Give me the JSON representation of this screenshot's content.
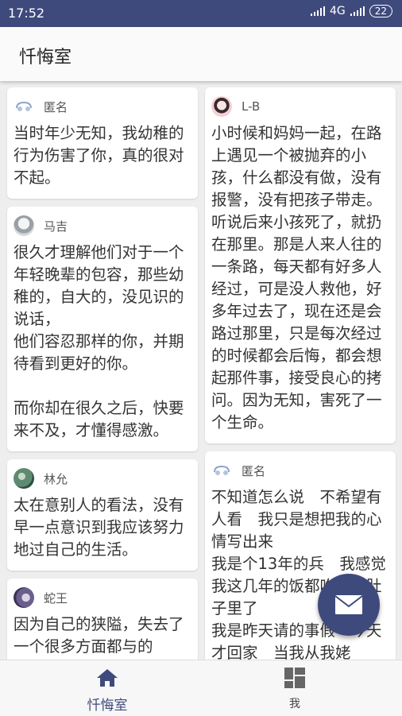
{
  "status": {
    "time": "17:52",
    "network": "4G",
    "battery": "22"
  },
  "app": {
    "title": "忏悔室"
  },
  "left_column": [
    {
      "user": "匿名",
      "avatar": "anonymous-icon",
      "text": "当时年少无知，我幼稚的行为伤害了你，真的很对不起。"
    },
    {
      "user": "马吉",
      "avatar": "user-avatar",
      "text": "很久才理解他们对于一个年轻晚辈的包容，那些幼稚的，自大的，没见识的说话，\n他们容忍那样的你，并期待看到更好的你。\n\n而你却在很久之后，快要来不及，才懂得感激。"
    },
    {
      "user": "林允",
      "avatar": "user-avatar",
      "text": "太在意别人的看法，没有早一点意识到我应该努力地过自己的生活。"
    },
    {
      "user": "蛇王",
      "avatar": "user-avatar",
      "text": "因为自己的狭隘，失去了一个很多方面都与的"
    }
  ],
  "right_column": [
    {
      "user": "L-B",
      "avatar": "user-avatar",
      "text": "小时候和妈妈一起，在路上遇见一个被抛弃的小孩，什么都没有做，没有报警，没有把孩子带走。听说后来小孩死了，就扔在那里。那是人来人往的一条路，每天都有好多人经过，可是没人救他，好多年过去了，现在还是会路过那里，只是每次经过的时候都会后悔，都会想起那件事，接受良心的拷问。因为无知，害死了一个生命。"
    },
    {
      "user": "匿名",
      "avatar": "anonymous-icon",
      "text": "不知道怎么说　不希望有人看　我只是想把我的心情写出来\n我是个13年的兵　我感觉我这几年的饭都吃到狗肚子里了\n我是昨天请的事假　今天才回家　当我从我姥"
    }
  ],
  "nav": {
    "home": "忏悔室",
    "me": "我"
  },
  "colors": {
    "primary": "#3f4a7c",
    "background": "#eeeeee"
  }
}
